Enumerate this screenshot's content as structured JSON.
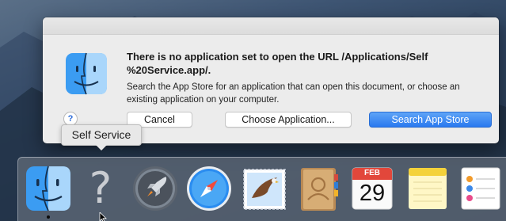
{
  "dialog": {
    "title": "There is no application set to open the URL /Applications/Self %20Service.app/.",
    "body": "Search the App Store for an application that can open this document, or choose an existing application on your computer.",
    "help_label": "?",
    "buttons": {
      "cancel": "Cancel",
      "choose": "Choose Application...",
      "search": "Search App Store"
    }
  },
  "tooltip": {
    "text": "Self Service"
  },
  "dock": {
    "items": [
      {
        "name": "finder",
        "icon": "finder-icon"
      },
      {
        "name": "self-service",
        "icon": "question-mark-icon"
      },
      {
        "name": "launchpad",
        "icon": "rocket-icon"
      },
      {
        "name": "safari",
        "icon": "compass-icon"
      },
      {
        "name": "mail",
        "icon": "stamp-eagle-icon"
      },
      {
        "name": "contacts",
        "icon": "address-book-icon"
      },
      {
        "name": "calendar",
        "icon": "calendar-icon"
      },
      {
        "name": "notes",
        "icon": "notes-icon"
      },
      {
        "name": "reminders",
        "icon": "reminders-icon"
      }
    ],
    "calendar": {
      "month": "FEB",
      "day": "29"
    },
    "question_glyph": "?"
  },
  "colors": {
    "accent": "#2a79ef",
    "dialog_bg": "#ececec"
  }
}
